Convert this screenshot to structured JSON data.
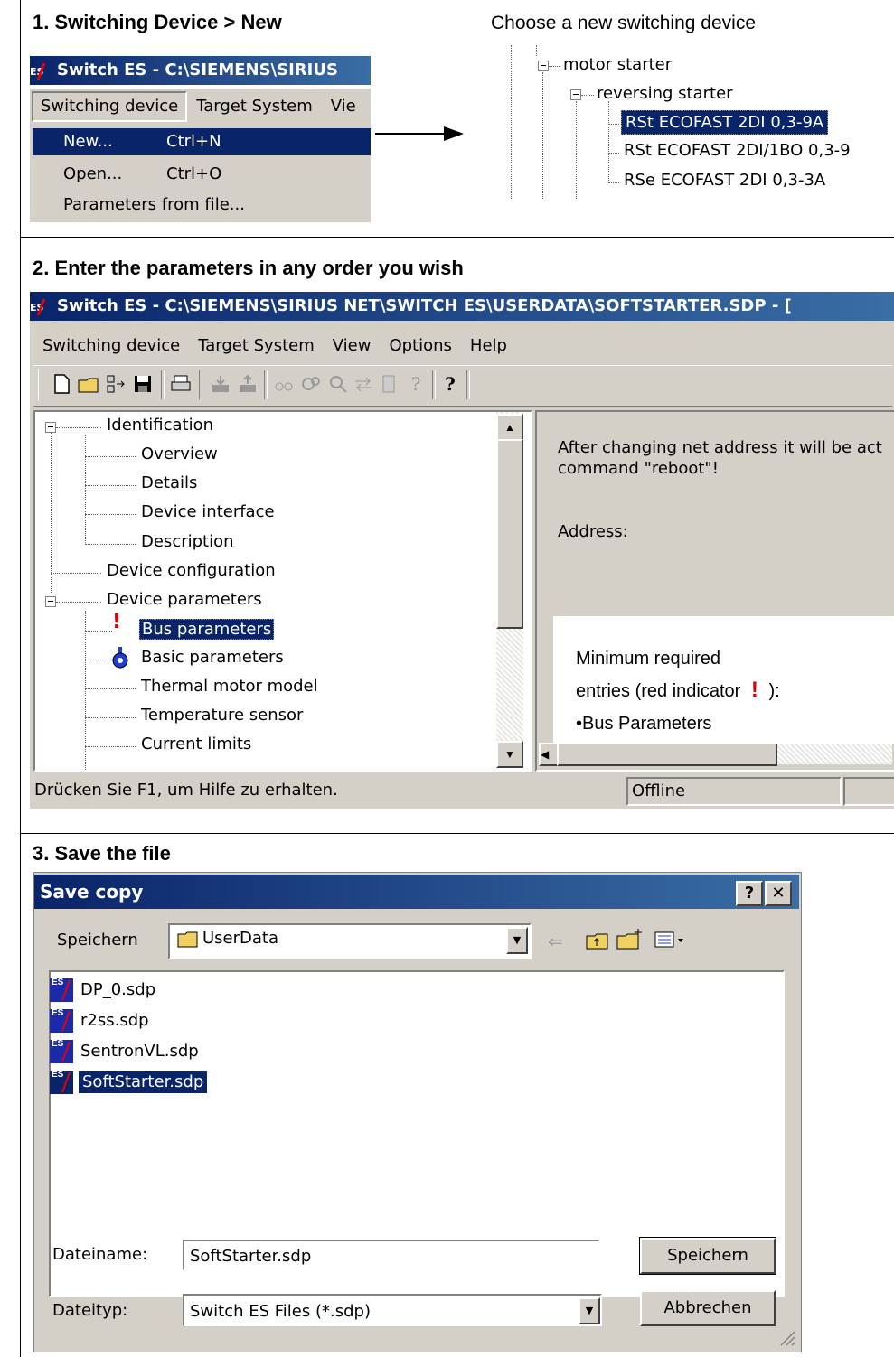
{
  "steps": {
    "step1": "1. Switching Device > New",
    "step2": "2. Enter the parameters in any order you wish",
    "step3": "3. Save the file"
  },
  "choose_label": "Choose a new switching device",
  "mini_app": {
    "title": "Switch ES - C:\\SIEMENS\\SIRIUS",
    "menu": [
      "Switching device",
      "Target System",
      "Vie"
    ],
    "dropdown": [
      {
        "label": "New...",
        "shortcut": "Ctrl+N"
      },
      {
        "label": "Open...",
        "shortcut": "Ctrl+O"
      },
      {
        "label": "Parameters from file...",
        "shortcut": ""
      }
    ]
  },
  "device_tree": {
    "root": "motor starter",
    "child": "reversing starter",
    "leaves": [
      "RSt ECOFAST  2DI 0,3-9A",
      "RSt ECOFAST  2DI/1BO 0,3-9",
      "RSe ECOFAST  2DI 0,3-3A"
    ]
  },
  "main_app": {
    "title": "Switch ES - C:\\SIEMENS\\SIRIUS NET\\SWITCH ES\\USERDATA\\SOFTSTARTER.SDP - [",
    "menu": [
      "Switching device",
      "Target System",
      "View",
      "Options",
      "Help"
    ],
    "tree": {
      "identification": "Identification",
      "overview": "Overview",
      "details": "Details",
      "device_interface": "Device interface",
      "description": "Description",
      "device_configuration": "Device configuration",
      "device_parameters": "Device parameters",
      "bus_parameters": "Bus parameters",
      "basic_parameters": "Basic parameters",
      "thermal_motor_model": "Thermal motor model",
      "temperature_sensor": "Temperature sensor",
      "current_limits": "Current limits"
    },
    "right_text1": "After changing net address it will be act",
    "right_text2": "command \"reboot\"!",
    "address_label": "Address:",
    "callout": {
      "line1": "Minimum required",
      "line2": "entries (red indicator",
      "line2_end": "):",
      "line3": "•Bus Parameters"
    },
    "status_text": "Drücken Sie F1, um Hilfe zu erhalten.",
    "status_mode": "Offline"
  },
  "save_dialog": {
    "title": "Save copy",
    "help_btn": "?",
    "close_btn": "✕",
    "speichern_in_label": "Speichern",
    "folder": "UserData",
    "files": [
      "DP_0.sdp",
      "r2ss.sdp",
      "SentronVL.sdp",
      "SoftStarter.sdp"
    ],
    "dateiname_label": "Dateiname:",
    "dateiname_value": "SoftStarter.sdp",
    "dateityp_label": "Dateityp:",
    "dateityp_value": "Switch ES Files (*.sdp)",
    "save_button": "Speichern",
    "cancel_button": "Abbrechen"
  },
  "colors": {
    "selection": "#0a246a",
    "dialog_bg": "#d4d0c8",
    "alert_red": "#e00000"
  }
}
